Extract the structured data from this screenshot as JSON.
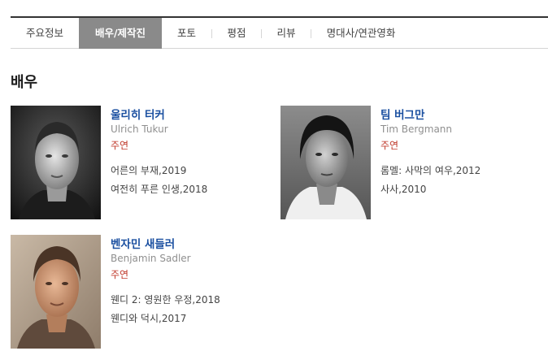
{
  "tabs": [
    {
      "label": "주요정보",
      "active": false
    },
    {
      "label": "배우/제작진",
      "active": true
    },
    {
      "label": "포토",
      "active": false
    },
    {
      "label": "평점",
      "active": false
    },
    {
      "label": "리뷰",
      "active": false
    },
    {
      "label": "명대사/연관영화",
      "active": false
    }
  ],
  "section_title": "배우",
  "colors": {
    "active_tab_bg": "#8a8a8a",
    "name_link": "#1a4fa0",
    "role": "#c0392b",
    "english_name": "#8f8f8f"
  },
  "people": [
    {
      "kor_name": "울리히 터커",
      "eng_name": "Ulrich Tukur",
      "role": "주연",
      "films": [
        "어른의 부재,2019",
        "여전히 푸른 인생,2018"
      ]
    },
    {
      "kor_name": "팀 버그만",
      "eng_name": "Tim Bergmann",
      "role": "주연",
      "films": [
        "롬멜: 사막의 여우,2012",
        "사사,2010"
      ]
    },
    {
      "kor_name": "벤자민 새들러",
      "eng_name": "Benjamin Sadler",
      "role": "주연",
      "films": [
        "웬디 2: 영원한 우정,2018",
        "웬디와 덕시,2017"
      ]
    }
  ]
}
